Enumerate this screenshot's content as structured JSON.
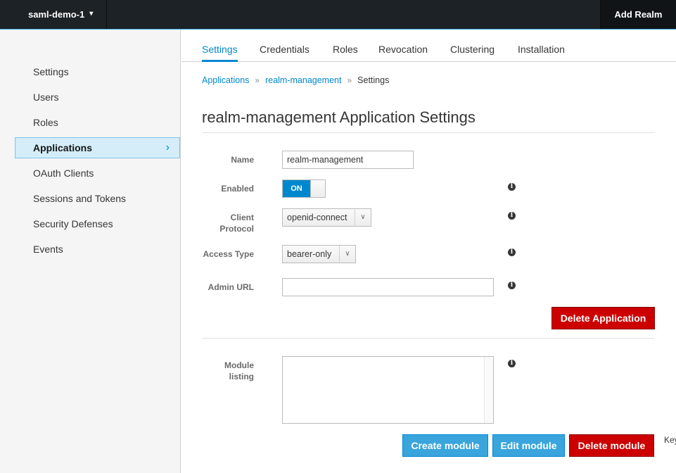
{
  "topbar": {
    "realm_name": "saml-demo-1",
    "add_realm_label": "Add Realm"
  },
  "sidebar": {
    "items": [
      {
        "label": "Settings"
      },
      {
        "label": "Users"
      },
      {
        "label": "Roles"
      },
      {
        "label": "Applications"
      },
      {
        "label": "OAuth Clients"
      },
      {
        "label": "Sessions and Tokens"
      },
      {
        "label": "Security Defenses"
      },
      {
        "label": "Events"
      }
    ],
    "active": "Applications"
  },
  "tabs": [
    {
      "label": "Settings"
    },
    {
      "label": "Credentials"
    },
    {
      "label": "Roles"
    },
    {
      "label": "Revocation"
    },
    {
      "label": "Clustering"
    },
    {
      "label": "Installation"
    }
  ],
  "active_tab": "Settings",
  "breadcrumb": {
    "items": [
      {
        "label": "Applications"
      },
      {
        "label": "realm-management"
      },
      {
        "label": "Settings"
      }
    ],
    "separator": "»"
  },
  "page_title": "realm-management Application Settings",
  "form": {
    "name_label": "Name",
    "name_value": "realm-management",
    "enabled_label": "Enabled",
    "enabled_value": "ON",
    "client_protocol_label_1": "Client",
    "client_protocol_label_2": "Protocol",
    "client_protocol_value": "openid-connect",
    "access_type_label": "Access Type",
    "access_type_value": "bearer-only",
    "admin_url_label": "Admin URL",
    "admin_url_value": "",
    "delete_application_label": "Delete Application",
    "module_listing_label_1": "Module",
    "module_listing_label_2": "listing",
    "create_module_label": "Create module",
    "edit_module_label": "Edit module",
    "delete_module_label": "Delete module",
    "cut_off_text": "Key"
  },
  "icons": {
    "info": "i",
    "chevron_down": "⌄",
    "chevron_right": "›",
    "caret_down": "∨"
  },
  "colors": {
    "accent": "#0088ce",
    "danger": "#cc0000",
    "primary_button": "#39a5dc",
    "topbar": "#1d2226"
  }
}
